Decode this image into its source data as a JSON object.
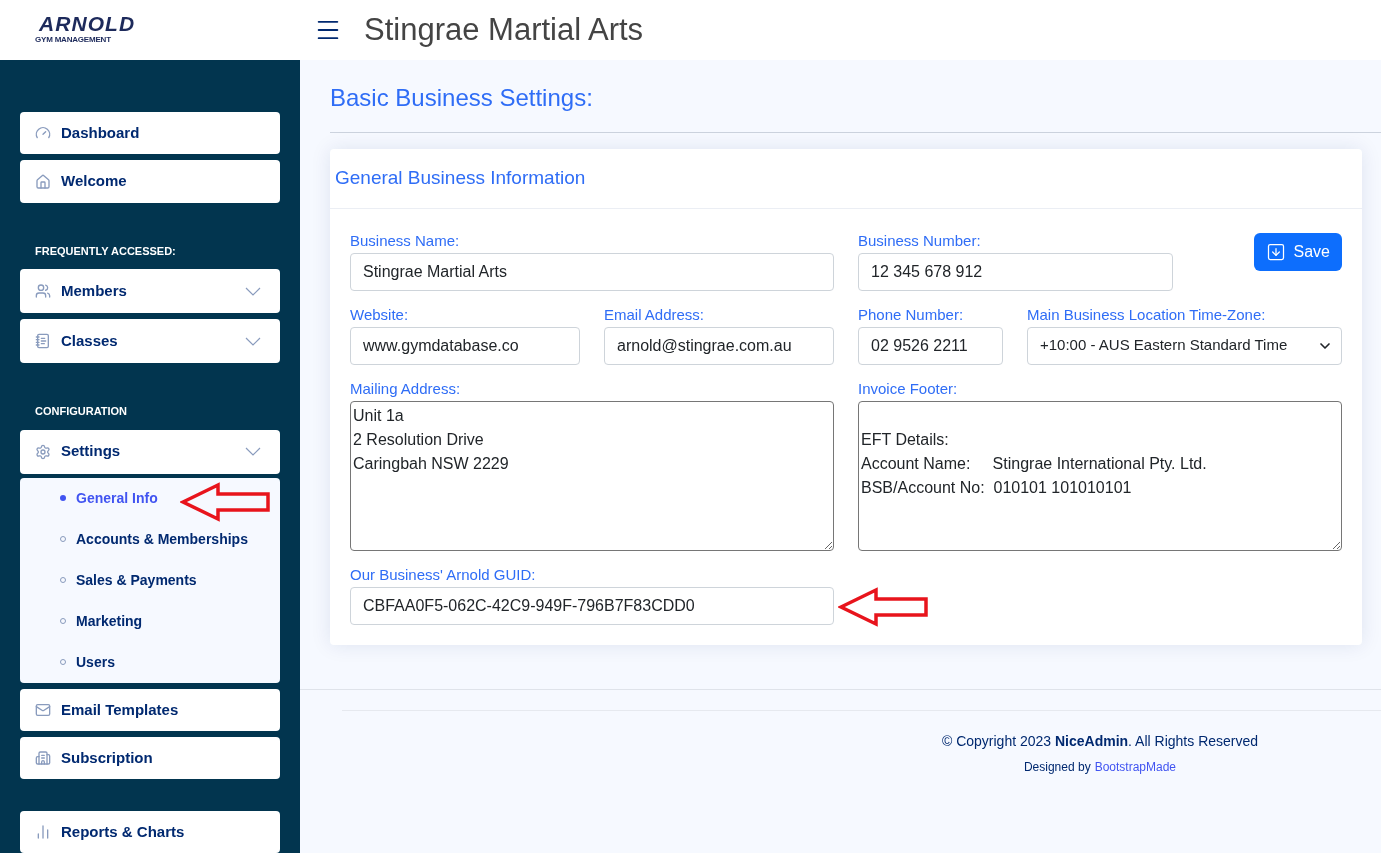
{
  "header": {
    "logo": {
      "title": "ARNOLD",
      "subtitle": "GYM MANAGEMENT"
    },
    "title": "Stingrae Martial Arts"
  },
  "sidebar": {
    "items": [
      {
        "kind": "link",
        "label": "Dashboard"
      },
      {
        "kind": "link",
        "label": "Welcome"
      },
      {
        "kind": "heading",
        "label": "FREQUENTLY ACCESSED:"
      },
      {
        "kind": "dropdown",
        "label": "Members",
        "expanded": false
      },
      {
        "kind": "dropdown",
        "label": "Classes",
        "expanded": false
      },
      {
        "kind": "heading",
        "label": "CONFIGURATION"
      },
      {
        "kind": "dropdown",
        "label": "Settings",
        "expanded": true,
        "children": [
          {
            "label": "General Info",
            "selected": true,
            "annotated": true
          },
          {
            "label": "Accounts & Memberships",
            "selected": false,
            "annotated": false
          },
          {
            "label": "Sales & Payments",
            "selected": false,
            "annotated": false
          },
          {
            "label": "Marketing",
            "selected": false,
            "annotated": false
          },
          {
            "label": "Users",
            "selected": false,
            "annotated": false
          }
        ]
      },
      {
        "kind": "link",
        "label": "Email Templates"
      },
      {
        "kind": "link",
        "label": "Subscription"
      },
      {
        "kind": "spacer"
      },
      {
        "kind": "link",
        "label": "Reports & Charts"
      }
    ]
  },
  "page_title": "Basic Business Settings:",
  "card": {
    "title": "General Business Information",
    "save_button": "Save",
    "business_name": {
      "label": "Business Name:",
      "value": "Stingrae Martial Arts"
    },
    "business_number": {
      "label": "Business Number:",
      "value": "12 345 678 912"
    },
    "website": {
      "label": "Website:",
      "value": "www.gymdatabase.co"
    },
    "email": {
      "label": "Email Address:",
      "value": "arnold@stingrae.com.au"
    },
    "phone": {
      "label": "Phone Number:",
      "value": "02 9526 2211"
    },
    "timezone": {
      "label": "Main Business Location Time-Zone:",
      "value": "+10:00 - AUS Eastern Standard Time"
    },
    "mailing_address": {
      "label": "Mailing Address:",
      "value": "Unit 1a\n2 Resolution Drive\nCaringbah NSW 2229"
    },
    "invoice_footer": {
      "label": "Invoice Footer:",
      "value": "\nEFT Details:\nAccount Name:     Stingrae International Pty. Ltd.\nBSB/Account No:  010101 101010101"
    },
    "guid": {
      "label": "Our Business' Arnold GUID:",
      "value": "CBFAA0F5-062C-42C9-949F-796B7F83CDD0",
      "annotated": true
    }
  },
  "footer": {
    "copyright": "© Copyright 2023 **NiceAdmin**. All Rights Reserved",
    "designed_by": "Designed by",
    "designer_link": "BootstrapMade"
  }
}
